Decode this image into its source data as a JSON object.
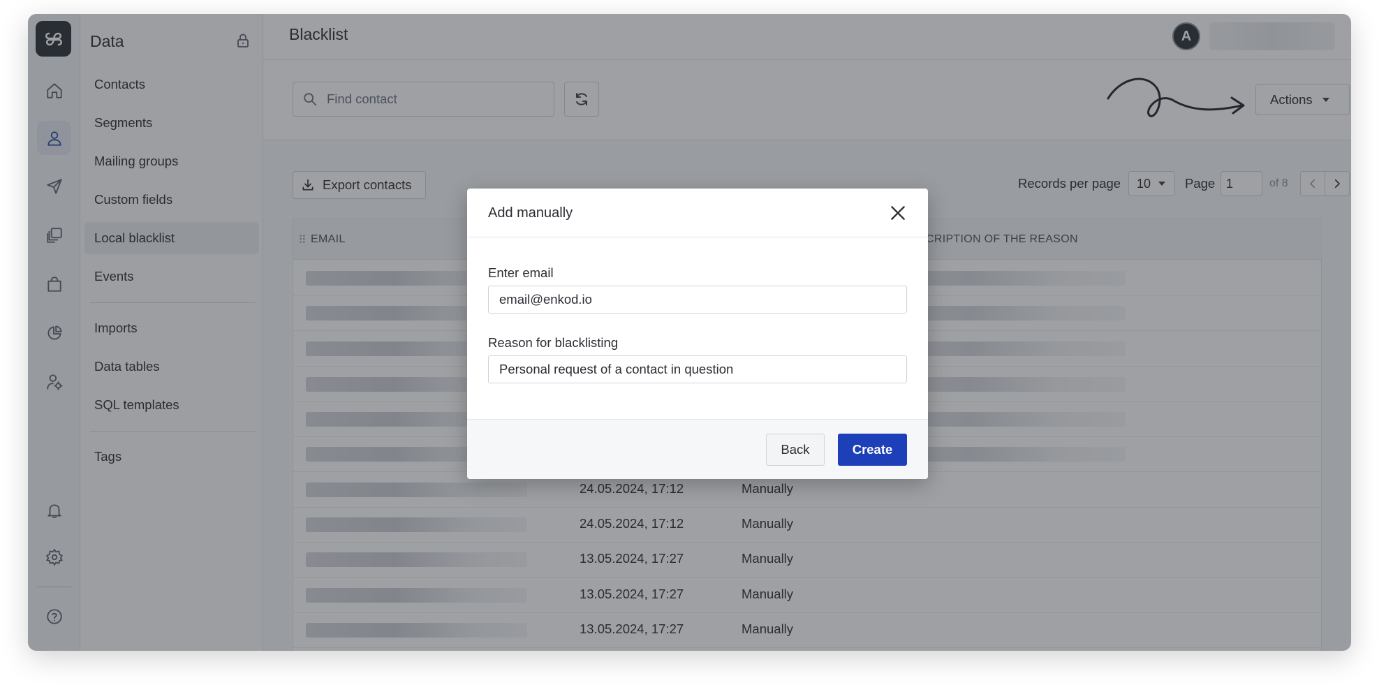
{
  "app": {
    "section_title": "Data",
    "page_title": "Blacklist",
    "avatar_initial": "A",
    "accent_color": "#1d3fb8"
  },
  "rail": {
    "items": [
      {
        "icon": "home-icon"
      },
      {
        "icon": "contacts-icon",
        "active": true
      },
      {
        "icon": "send-icon"
      },
      {
        "icon": "templates-icon"
      },
      {
        "icon": "shopping-bag-icon"
      },
      {
        "icon": "analytics-pie-icon"
      },
      {
        "icon": "user-settings-icon"
      },
      {
        "icon": "bell-icon"
      },
      {
        "icon": "gear-icon"
      },
      {
        "icon": "help-icon"
      }
    ]
  },
  "nav": {
    "items": [
      {
        "label": "Contacts"
      },
      {
        "label": "Segments"
      },
      {
        "label": "Mailing groups"
      },
      {
        "label": "Custom fields"
      },
      {
        "label": "Local blacklist",
        "active": true
      },
      {
        "label": "Events"
      },
      {
        "label": "Imports"
      },
      {
        "label": "Data tables"
      },
      {
        "label": "SQL templates"
      },
      {
        "label": "Tags"
      }
    ]
  },
  "toolbar": {
    "search_placeholder": "Find contact",
    "actions_label": "Actions",
    "export_label": "Export contacts"
  },
  "pagination": {
    "records_per_page_label": "Records per page",
    "records_per_page_value": "10",
    "page_label": "Page",
    "page_value": "1",
    "of_label": "of 8"
  },
  "table": {
    "columns": [
      "EMAIL",
      "CRIPTION OF THE REASON"
    ],
    "rows": [
      {
        "date": "",
        "method": ""
      },
      {
        "date": "",
        "method": ""
      },
      {
        "date": "",
        "method": ""
      },
      {
        "date": "",
        "method": ""
      },
      {
        "date": "",
        "method": ""
      },
      {
        "date": "",
        "method": ""
      },
      {
        "date": "24.05.2024, 17:12",
        "method": "Manually"
      },
      {
        "date": "24.05.2024, 17:12",
        "method": "Manually"
      },
      {
        "date": "13.05.2024, 17:27",
        "method": "Manually"
      },
      {
        "date": "13.05.2024, 17:27",
        "method": "Manually"
      },
      {
        "date": "13.05.2024, 17:27",
        "method": "Manually"
      }
    ]
  },
  "modal": {
    "title": "Add manually",
    "email_label": "Enter email",
    "email_value": "email@enkod.io",
    "reason_label": "Reason for blacklisting",
    "reason_value": "Personal request of a contact in question",
    "back_label": "Back",
    "create_label": "Create"
  }
}
